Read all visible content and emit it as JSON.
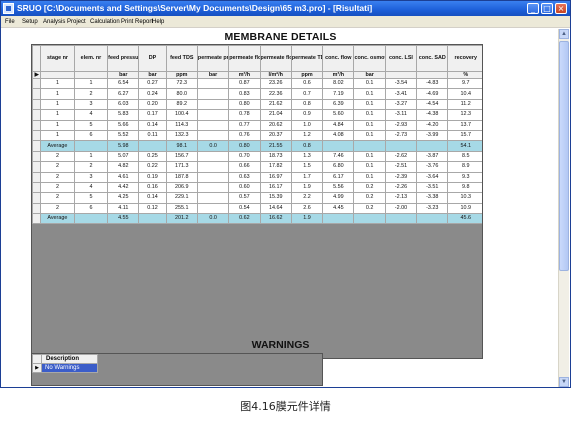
{
  "window": {
    "title": "SRUO [C:\\Documents and Settings\\Server\\My Documents\\Design\\65 m3.pro] - [Risultati]",
    "controls": {
      "minimize": "_",
      "maximize": "□",
      "close": "×"
    }
  },
  "menu": [
    "File",
    "Setup",
    "Analysis",
    "Project",
    "Calculation",
    "Print Report",
    "Help"
  ],
  "membrane": {
    "title": "MEMBRANE DETAILS",
    "headers": [
      "stage nr",
      "elem. nr",
      "feed pressure",
      "DP",
      "feed TDS",
      "permeate pressure",
      "permeate flow",
      "permeate flow",
      "permeate TDS",
      "conc. flow",
      "conc. osmotic pres.",
      "conc. LSI",
      "conc. SAD",
      "recovery"
    ],
    "units": [
      "",
      "",
      "bar",
      "bar",
      "ppm",
      "bar",
      "m³/h",
      "l/m²/h",
      "ppm",
      "m³/h",
      "bar",
      "",
      "",
      "%"
    ],
    "rows": [
      {
        "type": "data",
        "cells": [
          "1",
          "1",
          "6.54",
          "0.27",
          "72.3",
          "",
          "0.87",
          "23.26",
          "0.6",
          "8.02",
          "0.1",
          "-3.54",
          "-4.83",
          "9.7"
        ]
      },
      {
        "type": "data",
        "cells": [
          "1",
          "2",
          "6.27",
          "0.24",
          "80.0",
          "",
          "0.83",
          "22.36",
          "0.7",
          "7.19",
          "0.1",
          "-3.41",
          "-4.69",
          "10.4"
        ]
      },
      {
        "type": "data",
        "cells": [
          "1",
          "3",
          "6.03",
          "0.20",
          "89.2",
          "",
          "0.80",
          "21.62",
          "0.8",
          "6.39",
          "0.1",
          "-3.27",
          "-4.54",
          "11.2"
        ]
      },
      {
        "type": "data",
        "cells": [
          "1",
          "4",
          "5.83",
          "0.17",
          "100.4",
          "",
          "0.78",
          "21.04",
          "0.9",
          "5.60",
          "0.1",
          "-3.11",
          "-4.38",
          "12.3"
        ]
      },
      {
        "type": "data",
        "cells": [
          "1",
          "5",
          "5.66",
          "0.14",
          "114.3",
          "",
          "0.77",
          "20.62",
          "1.0",
          "4.84",
          "0.1",
          "-2.93",
          "-4.20",
          "13.7"
        ]
      },
      {
        "type": "data",
        "cells": [
          "1",
          "6",
          "5.52",
          "0.11",
          "132.3",
          "",
          "0.76",
          "20.37",
          "1.2",
          "4.08",
          "0.1",
          "-2.73",
          "-3.99",
          "15.7"
        ]
      },
      {
        "type": "avg",
        "cells": [
          "Average",
          "",
          "5.98",
          "",
          "98.1",
          "0.0",
          "0.80",
          "21.55",
          "0.8",
          "",
          "",
          "",
          "",
          "54.1"
        ]
      },
      {
        "type": "data",
        "cells": [
          "2",
          "1",
          "5.07",
          "0.25",
          "156.7",
          "",
          "0.70",
          "18.73",
          "1.3",
          "7.46",
          "0.1",
          "-2.62",
          "-3.87",
          "8.5"
        ]
      },
      {
        "type": "data",
        "cells": [
          "2",
          "2",
          "4.82",
          "0.22",
          "171.3",
          "",
          "0.66",
          "17.82",
          "1.5",
          "6.80",
          "0.1",
          "-2.51",
          "-3.76",
          "8.9"
        ]
      },
      {
        "type": "data",
        "cells": [
          "2",
          "3",
          "4.61",
          "0.19",
          "187.8",
          "",
          "0.63",
          "16.97",
          "1.7",
          "6.17",
          "0.1",
          "-2.39",
          "-3.64",
          "9.3"
        ]
      },
      {
        "type": "data",
        "cells": [
          "2",
          "4",
          "4.42",
          "0.16",
          "206.9",
          "",
          "0.60",
          "16.17",
          "1.9",
          "5.56",
          "0.2",
          "-2.26",
          "-3.51",
          "9.8"
        ]
      },
      {
        "type": "data",
        "cells": [
          "2",
          "5",
          "4.25",
          "0.14",
          "229.1",
          "",
          "0.57",
          "15.39",
          "2.2",
          "4.99",
          "0.2",
          "-2.13",
          "-3.38",
          "10.3"
        ]
      },
      {
        "type": "data",
        "cells": [
          "2",
          "6",
          "4.11",
          "0.12",
          "255.1",
          "",
          "0.54",
          "14.64",
          "2.6",
          "4.45",
          "0.2",
          "-2.00",
          "-3.23",
          "10.9"
        ]
      },
      {
        "type": "avg",
        "cells": [
          "Average",
          "",
          "4.55",
          "",
          "201.2",
          "0.0",
          "0.62",
          "16.62",
          "1.9",
          "",
          "",
          "",
          "",
          "45.6"
        ]
      }
    ]
  },
  "warnings": {
    "title": "WARNINGS",
    "header": "Description",
    "rows": [
      "No Warnings"
    ]
  },
  "caption": "图4.16膜元件详情"
}
